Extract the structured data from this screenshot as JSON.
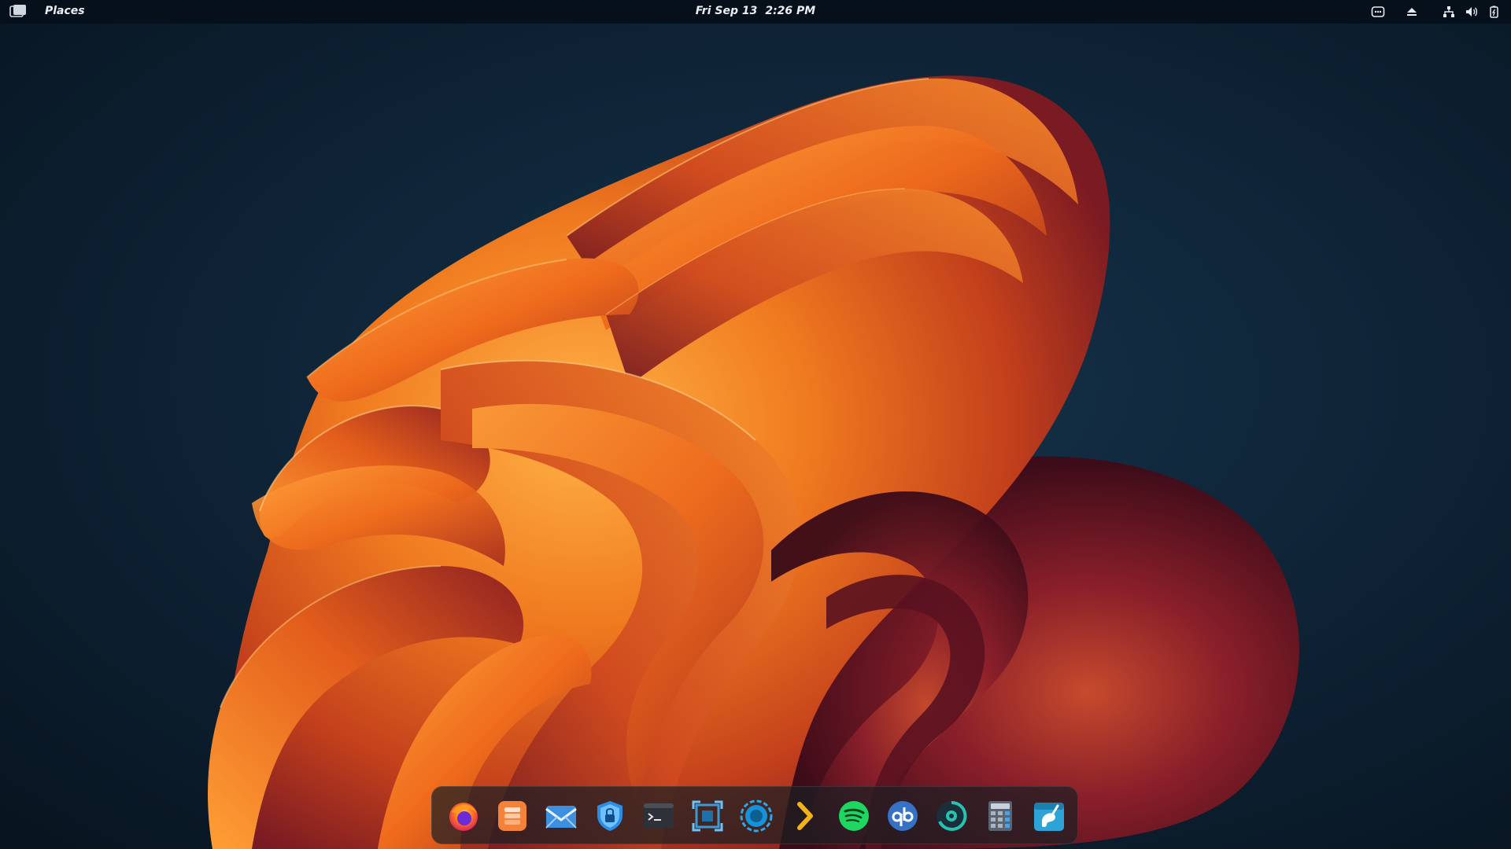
{
  "topbar": {
    "activities_icon": "activities-icon",
    "places_label": "Places",
    "date": "Fri Sep 13",
    "time": "2:26 PM",
    "tray": [
      {
        "name": "messaging-tray",
        "icon": "chat-bubble-icon"
      },
      {
        "name": "eject-tray",
        "icon": "eject-icon"
      },
      {
        "name": "network-tray",
        "icon": "network-icon"
      },
      {
        "name": "volume-tray",
        "icon": "volume-icon"
      },
      {
        "name": "battery-tray",
        "icon": "battery-icon"
      }
    ]
  },
  "dock": {
    "apps": [
      {
        "name": "firefox",
        "icon": "firefox-icon"
      },
      {
        "name": "app-stack",
        "icon": "stack-icon"
      },
      {
        "name": "mail",
        "icon": "mail-icon"
      },
      {
        "name": "vpn-shield",
        "icon": "shield-lock-icon"
      },
      {
        "name": "terminal",
        "icon": "terminal-icon"
      },
      {
        "name": "screenshot",
        "icon": "screenshot-icon"
      },
      {
        "name": "disc-app",
        "icon": "circle-app-icon"
      },
      {
        "name": "launcher",
        "icon": "chevron-right-icon"
      },
      {
        "name": "spotify",
        "icon": "spotify-icon"
      },
      {
        "name": "qbittorrent",
        "icon": "qbittorrent-icon"
      },
      {
        "name": "dial-app",
        "icon": "dial-icon"
      },
      {
        "name": "calculator",
        "icon": "calculator-icon"
      },
      {
        "name": "gimp",
        "icon": "gimp-icon"
      }
    ]
  },
  "colors": {
    "topbar_bg": "#06101a",
    "desktop_bg": "#0f2538",
    "petal_orange": "#f07a1f",
    "petal_deep": "#8a1f2a"
  }
}
